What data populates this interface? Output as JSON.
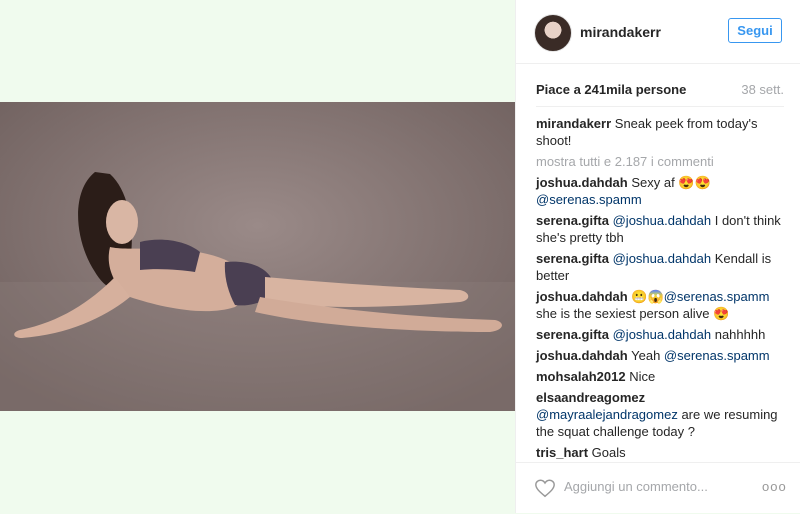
{
  "post": {
    "author": "mirandakerr",
    "follow_label": "Segui",
    "likes_label": "Piace a 241mila persone",
    "time": "38 sett.",
    "caption_user": "mirandakerr",
    "caption_text": "Sneak peek from today's shoot!",
    "load_more": "mostra tutti e 2.187 i commenti",
    "add_comment_placeholder": "Aggiungi un commento...",
    "more_label": "ooo"
  },
  "comments": [
    {
      "user": "joshua.dahdah",
      "text_before": "Sexy af ",
      "mention": "@serenas.spamm",
      "text_after": "",
      "emoji": "😍😍"
    },
    {
      "user": "serena.gifta",
      "mention": "@joshua.dahdah",
      "text_after": " I don't think she's pretty tbh"
    },
    {
      "user": "serena.gifta",
      "mention": "@joshua.dahdah",
      "text_after": " Kendall is better"
    },
    {
      "user": "joshua.dahdah",
      "emoji_before": "😬😱",
      "mention": "@serenas.spamm",
      "text_after": " she is the sexiest person alive ",
      "emoji": "😍"
    },
    {
      "user": "serena.gifta",
      "mention": "@joshua.dahdah",
      "text_after": " nahhhhh"
    },
    {
      "user": "joshua.dahdah",
      "text_before": "Yeah ",
      "mention": "@serenas.spamm"
    },
    {
      "user": "mohsalah2012",
      "text_before": "Nice"
    },
    {
      "user": "elsaandreagomez",
      "mention": "@mayraalejandragomez",
      "text_after": " are we resuming the squat challenge today ?"
    },
    {
      "user": "tris_hart",
      "text_before": "Goals"
    }
  ],
  "colors": {
    "accent": "#3897f0",
    "mention": "#003569",
    "muted": "#a5a7aa",
    "background": "#f0fbee"
  }
}
